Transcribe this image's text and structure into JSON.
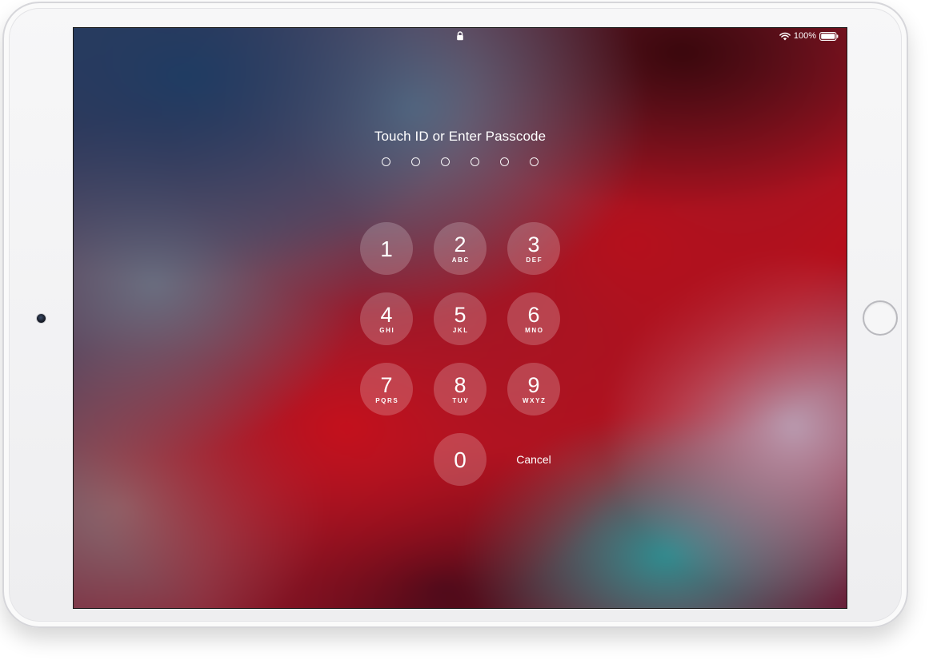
{
  "status_bar": {
    "lock_icon": "lock-icon",
    "wifi_icon": "wifi-icon",
    "battery_icon": "battery-icon",
    "battery_percent": "100%"
  },
  "lock_screen": {
    "prompt": "Touch ID or Enter Passcode",
    "passcode_length": 6,
    "passcode_entered": 0,
    "keys": [
      {
        "digit": "1",
        "letters": ""
      },
      {
        "digit": "2",
        "letters": "ABC"
      },
      {
        "digit": "3",
        "letters": "DEF"
      },
      {
        "digit": "4",
        "letters": "GHI"
      },
      {
        "digit": "5",
        "letters": "JKL"
      },
      {
        "digit": "6",
        "letters": "MNO"
      },
      {
        "digit": "7",
        "letters": "PQRS"
      },
      {
        "digit": "8",
        "letters": "TUV"
      },
      {
        "digit": "9",
        "letters": "WXYZ"
      },
      {
        "digit": "0",
        "letters": ""
      }
    ],
    "cancel_label": "Cancel"
  },
  "device": {
    "home_button": "home-button",
    "camera": "front-camera"
  },
  "colors": {
    "accent_red": "#c4101c",
    "text": "#ffffff"
  }
}
